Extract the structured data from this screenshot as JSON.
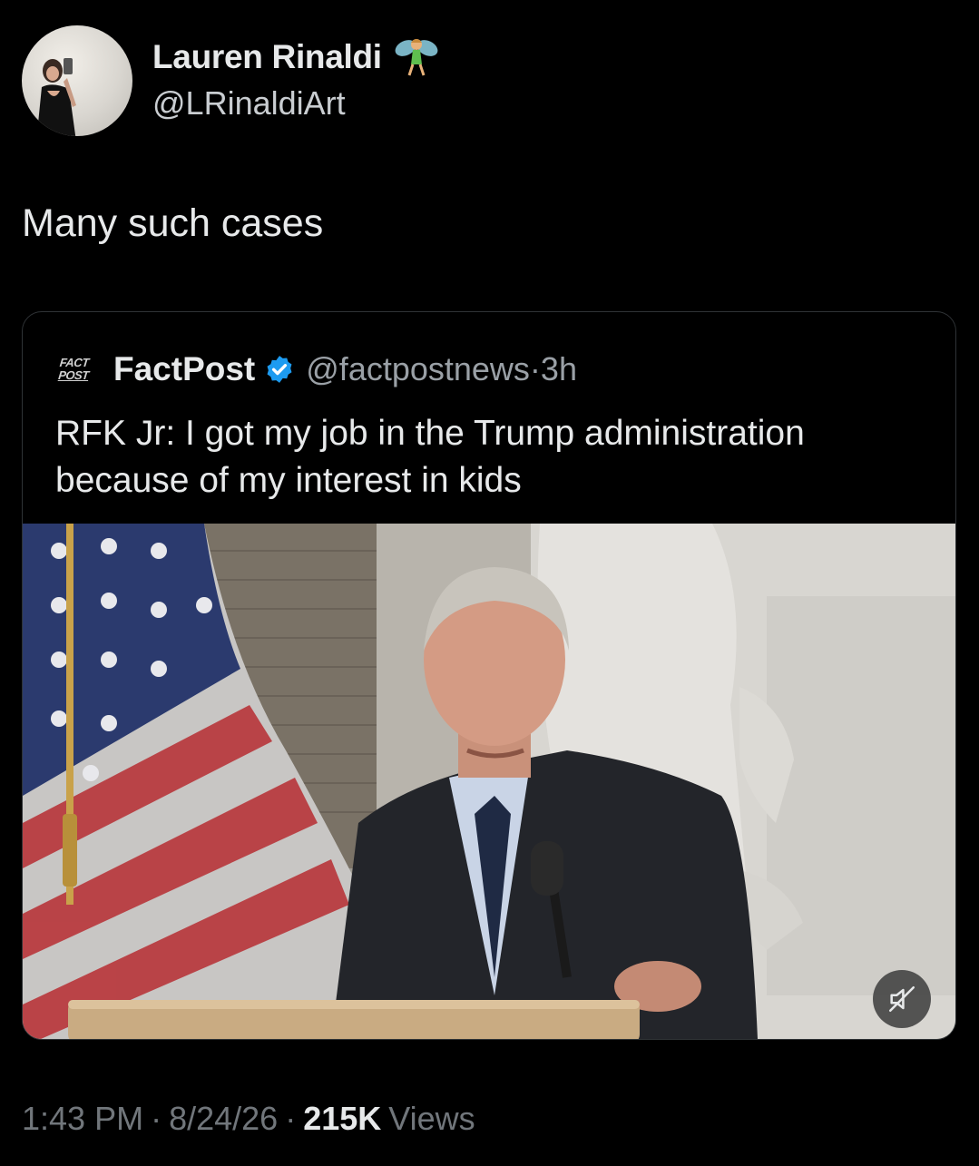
{
  "tweet": {
    "author_name": "Lauren Rinaldi",
    "author_handle": "@LRinaldiArt",
    "name_emoji": "fairy-emoji",
    "text": "Many such cases"
  },
  "quoted": {
    "logo_line1": "FACT",
    "logo_line2": "POST",
    "name": "FactPost",
    "verified_icon": "verified-badge-icon",
    "handle": "@factpostnews",
    "separator": "·",
    "time": "3h",
    "text": "RFK Jr: I got my job in the Trump administration because of my interest in kids",
    "media": {
      "type": "video",
      "mute_icon": "muted-speaker-icon"
    }
  },
  "meta": {
    "time": "1:43 PM",
    "sep1": "·",
    "date": "8/24/26",
    "sep2": "·",
    "views_count": "215K",
    "views_label": "Views"
  },
  "colors": {
    "background": "#000000",
    "text": "#e7e9ea",
    "secondary": "#71767b",
    "verified_blue": "#1d9bf0",
    "border": "#2f3336"
  }
}
